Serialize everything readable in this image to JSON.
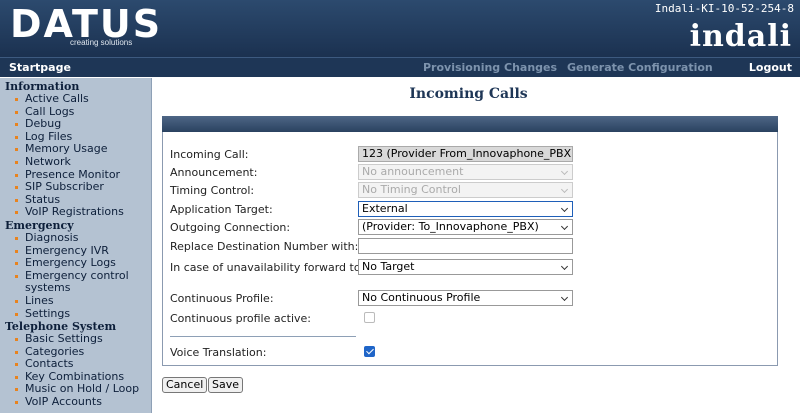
{
  "header": {
    "logo": "DATUS",
    "logo_tagline": "creating solutions",
    "hostname": "Indali-KI-10-52-254-8",
    "brand": "indali"
  },
  "nav": {
    "startpage": "Startpage",
    "provisioning": "Provisioning Changes",
    "generate": "Generate Configuration",
    "logout": "Logout"
  },
  "sidebar": {
    "information": {
      "title": "Information",
      "items": [
        "Active Calls",
        "Call Logs",
        "Debug",
        "Log Files",
        "Memory Usage",
        "Network",
        "Presence Monitor",
        "SIP Subscriber",
        "Status",
        "VoIP Registrations"
      ]
    },
    "emergency": {
      "title": "Emergency",
      "items": [
        "Diagnosis",
        "Emergency IVR",
        "Emergency Logs",
        "Emergency control",
        "systems",
        "Lines",
        "Settings"
      ]
    },
    "telephone": {
      "title": "Telephone System",
      "items": [
        "Basic Settings",
        "Categories",
        "Contacts",
        "Key Combinations",
        "Music on Hold / Loop",
        "VoIP Accounts"
      ]
    }
  },
  "page": {
    "title": "Incoming Calls"
  },
  "form": {
    "incoming_call": {
      "label": "Incoming Call:",
      "value": "123 (Provider From_Innovaphone_PBX)"
    },
    "announcement": {
      "label": "Announcement:",
      "value": "No announcement"
    },
    "timing_control": {
      "label": "Timing Control:",
      "value": "No Timing Control"
    },
    "application_target": {
      "label": "Application Target:",
      "value": "External"
    },
    "outgoing_connection": {
      "label": "Outgoing Connection:",
      "value": "(Provider: To_Innovaphone_PBX)"
    },
    "replace_destination": {
      "label": "Replace Destination Number with:",
      "value": ""
    },
    "unavailability_forward": {
      "label": "In case of unavailability forward to:",
      "value": "No Target"
    },
    "continuous_profile": {
      "label": "Continuous Profile:",
      "value": "No Continuous Profile"
    },
    "continuous_active": {
      "label": "Continuous profile active:",
      "checked": false
    },
    "voice_translation": {
      "label": "Voice Translation:",
      "checked": true
    }
  },
  "buttons": {
    "cancel": "Cancel",
    "save": "Save"
  },
  "colors": {
    "header_bg": "#1b3150",
    "sidebar_bg": "#b4c2d2",
    "bullet": "#e8831f",
    "accent": "#1f65c8"
  }
}
